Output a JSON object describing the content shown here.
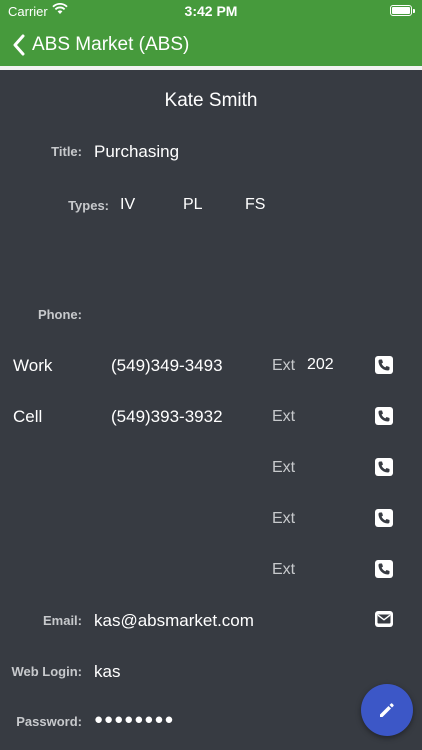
{
  "status_bar": {
    "carrier": "Carrier",
    "time": "3:42 PM"
  },
  "nav": {
    "title": "ABS Market (ABS)"
  },
  "contact": {
    "name": "Kate Smith",
    "title_label": "Title:",
    "title_value": "Purchasing",
    "types_label": "Types:",
    "types": [
      "IV",
      "PL",
      "FS"
    ],
    "phone_label": "Phone:",
    "phones": [
      {
        "type": "Work",
        "number": "(549)349-3493",
        "ext_label": "Ext",
        "ext": "202"
      },
      {
        "type": "Cell",
        "number": "(549)393-3932",
        "ext_label": "Ext",
        "ext": ""
      },
      {
        "type": "",
        "number": "",
        "ext_label": "Ext",
        "ext": ""
      },
      {
        "type": "",
        "number": "",
        "ext_label": "Ext",
        "ext": ""
      },
      {
        "type": "",
        "number": "",
        "ext_label": "Ext",
        "ext": ""
      }
    ],
    "email_label": "Email:",
    "email": "kas@absmarket.com",
    "weblogin_label": "Web Login:",
    "weblogin": "kas",
    "password_label": "Password:",
    "password": "●●●●●●●●"
  },
  "icons": {
    "back": "chevron-left-icon",
    "phone": "phone-icon",
    "email": "envelope-icon",
    "edit": "pencil-icon"
  },
  "colors": {
    "header": "#469a3c",
    "background": "#373b42",
    "fab": "#3c57c7",
    "label": "#c7c9cc"
  }
}
